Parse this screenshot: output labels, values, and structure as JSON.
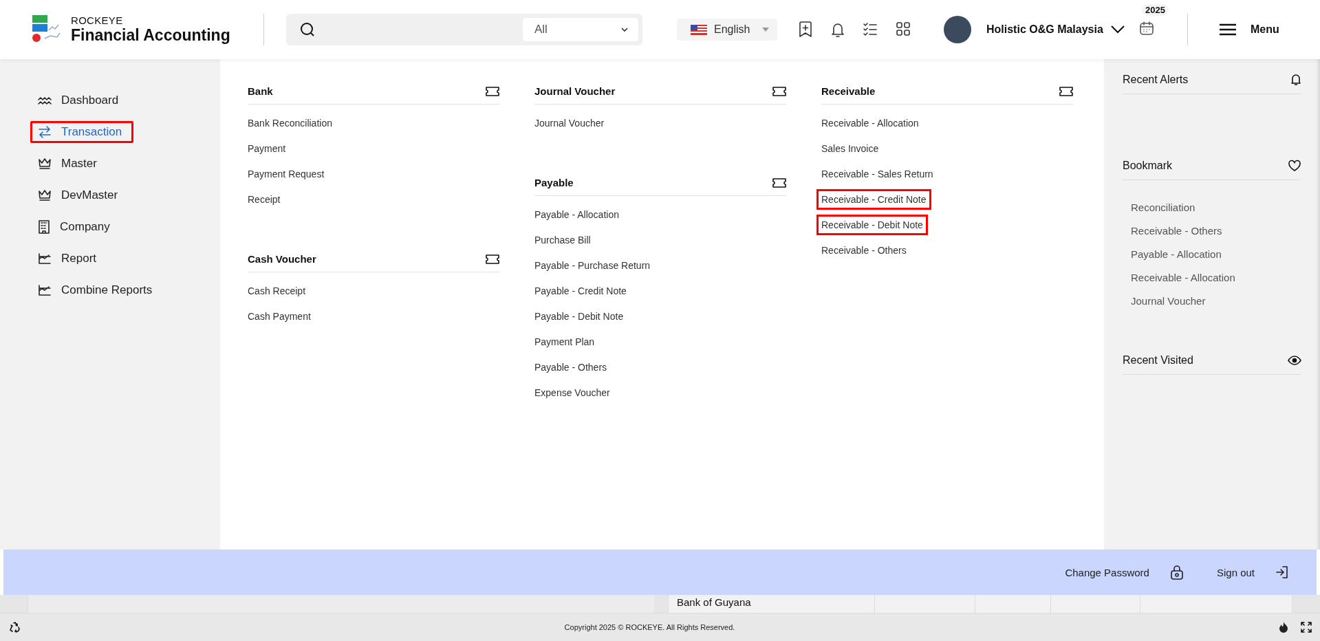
{
  "header": {
    "brand_top": "ROCKEYE",
    "brand_name": "Financial Accounting",
    "scope": "All",
    "language": "English",
    "company": "Holistic O&G Malaysia",
    "year": "2025",
    "menu": "Menu"
  },
  "sidebar": {
    "items": [
      {
        "label": "Dashboard",
        "kind": "dashboard",
        "selected": false,
        "highlighted": false
      },
      {
        "label": "Transaction",
        "kind": "transfer",
        "selected": true,
        "highlighted": true
      },
      {
        "label": "Master",
        "kind": "crown",
        "selected": false,
        "highlighted": false
      },
      {
        "label": "DevMaster",
        "kind": "crown",
        "selected": false,
        "highlighted": false
      },
      {
        "label": "Company",
        "kind": "building",
        "selected": false,
        "highlighted": false
      },
      {
        "label": "Report",
        "kind": "report",
        "selected": false,
        "highlighted": false
      },
      {
        "label": "Combine Reports",
        "kind": "report",
        "selected": false,
        "highlighted": false
      }
    ]
  },
  "menu": {
    "columns": [
      {
        "groups": [
          {
            "title": "Bank",
            "items": [
              {
                "label": "Bank Reconciliation",
                "highlighted": false
              },
              {
                "label": "Payment",
                "highlighted": false
              },
              {
                "label": "Payment Request",
                "highlighted": false
              },
              {
                "label": "Receipt",
                "highlighted": false
              }
            ]
          },
          {
            "title": "Cash Voucher",
            "items": [
              {
                "label": "Cash Receipt",
                "highlighted": false
              },
              {
                "label": "Cash Payment",
                "highlighted": false
              }
            ]
          }
        ]
      },
      {
        "groups": [
          {
            "title": "Journal Voucher",
            "items": [
              {
                "label": "Journal Voucher",
                "highlighted": false
              }
            ]
          },
          {
            "title": "Payable",
            "items": [
              {
                "label": "Payable - Allocation",
                "highlighted": false
              },
              {
                "label": "Purchase Bill",
                "highlighted": false
              },
              {
                "label": "Payable - Purchase Return",
                "highlighted": false
              },
              {
                "label": "Payable - Credit Note",
                "highlighted": false
              },
              {
                "label": "Payable - Debit Note",
                "highlighted": false
              },
              {
                "label": "Payment Plan",
                "highlighted": false
              },
              {
                "label": "Payable - Others",
                "highlighted": false
              },
              {
                "label": "Expense Voucher",
                "highlighted": false
              }
            ]
          }
        ]
      },
      {
        "groups": [
          {
            "title": "Receivable",
            "items": [
              {
                "label": "Receivable - Allocation",
                "highlighted": false
              },
              {
                "label": "Sales Invoice",
                "highlighted": false
              },
              {
                "label": "Receivable - Sales Return",
                "highlighted": false
              },
              {
                "label": "Receivable - Credit Note",
                "highlighted": true
              },
              {
                "label": "Receivable - Debit Note",
                "highlighted": true
              },
              {
                "label": "Receivable - Others",
                "highlighted": false
              }
            ]
          }
        ]
      }
    ]
  },
  "panel": {
    "sections": [
      {
        "title": "Recent Alerts",
        "kind": "bell"
      },
      {
        "title": "Bookmark",
        "kind": "heart",
        "items": [
          "Reconciliation",
          "Receivable - Others",
          "Payable - Allocation",
          "Receivable - Allocation",
          "Journal Voucher"
        ]
      },
      {
        "title": "Recent Visited",
        "kind": "eye"
      }
    ]
  },
  "account_bar": {
    "actions": [
      {
        "label": "Change Password",
        "kind": "lock"
      },
      {
        "label": "Sign out",
        "kind": "exit"
      }
    ]
  },
  "background_table": {
    "cell": "Bank of Guyana"
  },
  "footer": {
    "copyright": "Copyright 2025 © ROCKEYE. All Rights Reserved."
  }
}
